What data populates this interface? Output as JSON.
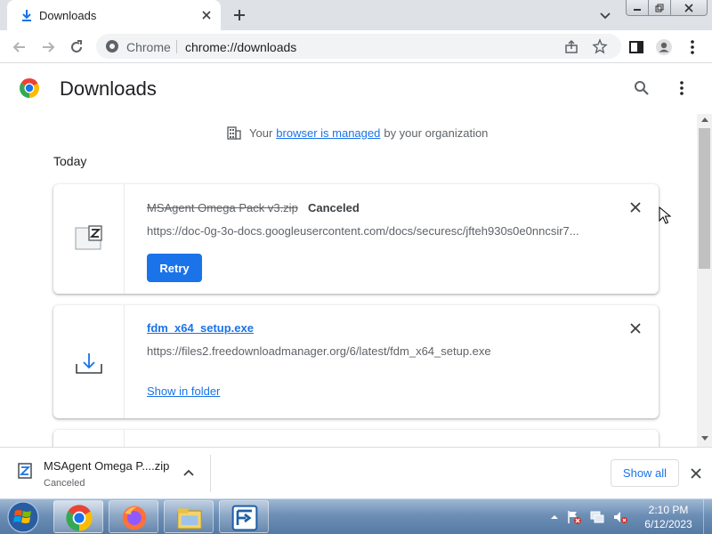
{
  "tab": {
    "title": "Downloads"
  },
  "toolbar": {
    "site_label": "Chrome",
    "url": "chrome://downloads"
  },
  "page": {
    "title": "Downloads"
  },
  "managed": {
    "prefix": "Your",
    "link": "browser is managed",
    "suffix": "by your organization"
  },
  "date_header": "Today",
  "downloads": [
    {
      "file_name": "MSAgent Omega Pack v3.zip",
      "status": "Canceled",
      "url": "https://doc-0g-3o-docs.googleusercontent.com/docs/securesc/jfteh930s0e0nncsir7...",
      "action": "Retry"
    },
    {
      "file_name": "fdm_x64_setup.exe",
      "url": "https://files2.freedownloadmanager.org/6/latest/fdm_x64_setup.exe",
      "action": "Show in folder"
    }
  ],
  "shelf": {
    "file_name": "MSAgent Omega P....zip",
    "status": "Canceled",
    "show_all": "Show all"
  },
  "taskbar": {
    "time": "2:10 PM",
    "date": "6/12/2023",
    "apps": [
      "chrome-icon",
      "firefox-icon",
      "file-explorer-icon",
      "free-download-manager-icon"
    ]
  },
  "colors": {
    "accent": "#1a73e8",
    "tabstrip": "#dee1e6",
    "text": "#202124",
    "secondary_text": "#5f6368"
  }
}
